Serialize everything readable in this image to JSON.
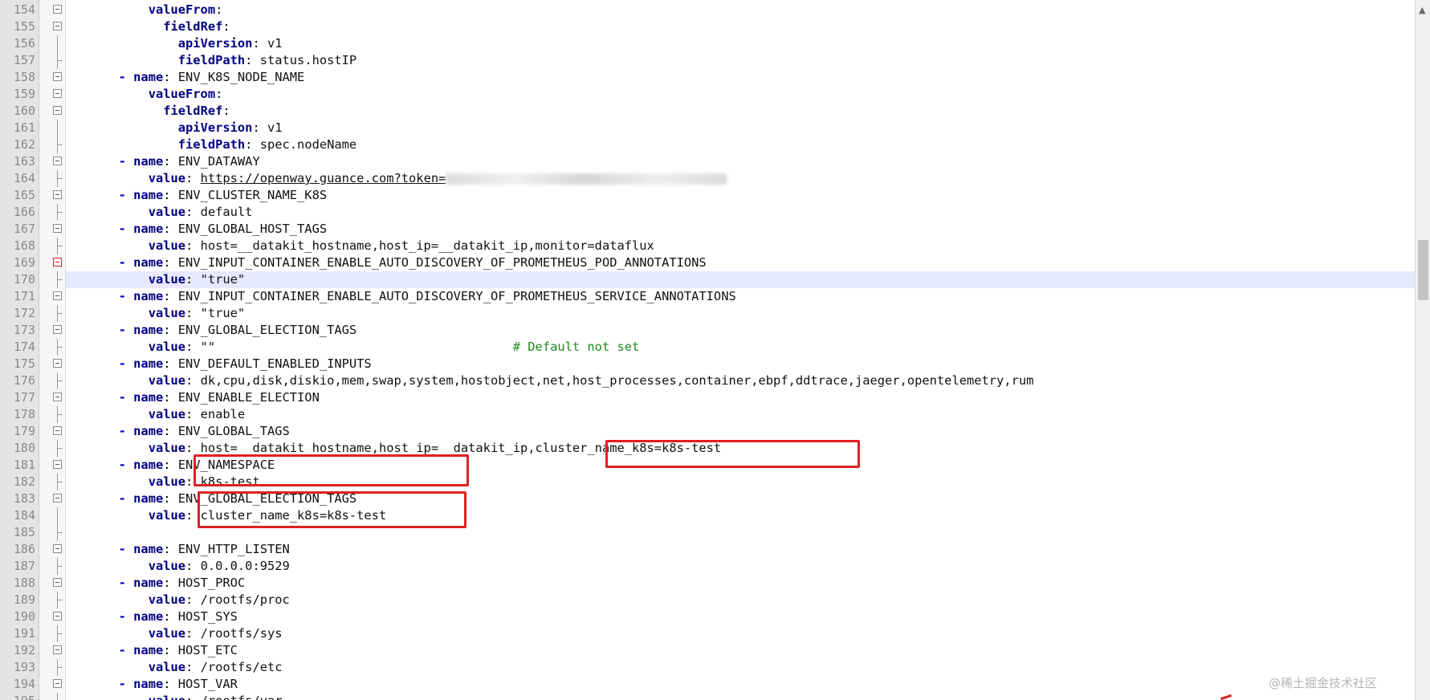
{
  "editor": {
    "current_line": 170,
    "lines": [
      {
        "n": "154",
        "fold": "box",
        "indent": 5,
        "dash": false,
        "key": "valueFrom",
        "colon": ":",
        "val": ""
      },
      {
        "n": "155",
        "fold": "box",
        "indent": 6,
        "dash": false,
        "key": "fieldRef",
        "colon": ":",
        "val": ""
      },
      {
        "n": "156",
        "fold": "line",
        "indent": 7,
        "dash": false,
        "key": "apiVersion",
        "colon": ":",
        "val": " v1"
      },
      {
        "n": "157",
        "fold": "end",
        "indent": 7,
        "dash": false,
        "key": "fieldPath",
        "colon": ":",
        "val": " status.hostIP"
      },
      {
        "n": "158",
        "fold": "box",
        "indent": 4,
        "dash": true,
        "key": "name",
        "colon": ":",
        "val": " ENV_K8S_NODE_NAME"
      },
      {
        "n": "159",
        "fold": "box",
        "indent": 5,
        "dash": false,
        "key": "valueFrom",
        "colon": ":",
        "val": ""
      },
      {
        "n": "160",
        "fold": "box",
        "indent": 6,
        "dash": false,
        "key": "fieldRef",
        "colon": ":",
        "val": ""
      },
      {
        "n": "161",
        "fold": "line",
        "indent": 7,
        "dash": false,
        "key": "apiVersion",
        "colon": ":",
        "val": " v1"
      },
      {
        "n": "162",
        "fold": "end",
        "indent": 7,
        "dash": false,
        "key": "fieldPath",
        "colon": ":",
        "val": " spec.nodeName"
      },
      {
        "n": "163",
        "fold": "box",
        "indent": 4,
        "dash": true,
        "key": "name",
        "colon": ":",
        "val": " ENV_DATAWAY"
      },
      {
        "n": "164",
        "fold": "end",
        "indent": 5,
        "dash": false,
        "key": "value",
        "colon": ":",
        "val": " ",
        "url": "https://openway.guance.com?token=",
        "blur": true
      },
      {
        "n": "165",
        "fold": "box",
        "indent": 4,
        "dash": true,
        "key": "name",
        "colon": ":",
        "val": " ENV_CLUSTER_NAME_K8S"
      },
      {
        "n": "166",
        "fold": "end",
        "indent": 5,
        "dash": false,
        "key": "value",
        "colon": ":",
        "val": " default"
      },
      {
        "n": "167",
        "fold": "box",
        "indent": 4,
        "dash": true,
        "key": "name",
        "colon": ":",
        "val": " ENV_GLOBAL_HOST_TAGS"
      },
      {
        "n": "168",
        "fold": "end",
        "indent": 5,
        "dash": false,
        "key": "value",
        "colon": ":",
        "val": " host=__datakit_hostname,host_ip=__datakit_ip,monitor=dataflux"
      },
      {
        "n": "169",
        "fold": "redbox",
        "indent": 4,
        "dash": true,
        "key": "name",
        "colon": ":",
        "val": " ENV_INPUT_CONTAINER_ENABLE_AUTO_DISCOVERY_OF_PROMETHEUS_POD_ANNOTATIONS"
      },
      {
        "n": "170",
        "fold": "end",
        "indent": 5,
        "dash": false,
        "key": "value",
        "colon": ":",
        "val": " \"true\""
      },
      {
        "n": "171",
        "fold": "box",
        "indent": 4,
        "dash": true,
        "key": "name",
        "colon": ":",
        "val": " ENV_INPUT_CONTAINER_ENABLE_AUTO_DISCOVERY_OF_PROMETHEUS_SERVICE_ANNOTATIONS"
      },
      {
        "n": "172",
        "fold": "end",
        "indent": 5,
        "dash": false,
        "key": "value",
        "colon": ":",
        "val": " \"true\""
      },
      {
        "n": "173",
        "fold": "box",
        "indent": 4,
        "dash": true,
        "key": "name",
        "colon": ":",
        "val": " ENV_GLOBAL_ELECTION_TAGS"
      },
      {
        "n": "174",
        "fold": "end",
        "indent": 5,
        "dash": false,
        "key": "value",
        "colon": ":",
        "val": " \"\"                                        ",
        "comment": "# Default not set"
      },
      {
        "n": "175",
        "fold": "box",
        "indent": 4,
        "dash": true,
        "key": "name",
        "colon": ":",
        "val": " ENV_DEFAULT_ENABLED_INPUTS"
      },
      {
        "n": "176",
        "fold": "end",
        "indent": 5,
        "dash": false,
        "key": "value",
        "colon": ":",
        "val": " dk,cpu,disk,diskio,mem,swap,system,hostobject,net,host_processes,container,ebpf,ddtrace,jaeger,opentelemetry,rum"
      },
      {
        "n": "177",
        "fold": "box",
        "indent": 4,
        "dash": true,
        "key": "name",
        "colon": ":",
        "val": " ENV_ENABLE_ELECTION"
      },
      {
        "n": "178",
        "fold": "end",
        "indent": 5,
        "dash": false,
        "key": "value",
        "colon": ":",
        "val": " enable"
      },
      {
        "n": "179",
        "fold": "box",
        "indent": 4,
        "dash": true,
        "key": "name",
        "colon": ":",
        "val": " ENV_GLOBAL_TAGS"
      },
      {
        "n": "180",
        "fold": "end",
        "indent": 5,
        "dash": false,
        "key": "value",
        "colon": ":",
        "val": " host=__datakit_hostname,host_ip=__datakit_ip,cluster_name_k8s=k8s-test"
      },
      {
        "n": "181",
        "fold": "box",
        "indent": 4,
        "dash": true,
        "key": "name",
        "colon": ":",
        "val": " ENV_NAMESPACE"
      },
      {
        "n": "182",
        "fold": "end",
        "indent": 5,
        "dash": false,
        "key": "value",
        "colon": ":",
        "val": " k8s-test"
      },
      {
        "n": "183",
        "fold": "box",
        "indent": 4,
        "dash": true,
        "key": "name",
        "colon": ":",
        "val": " ENV_GLOBAL_ELECTION_TAGS"
      },
      {
        "n": "184",
        "fold": "line",
        "indent": 5,
        "dash": false,
        "key": "value",
        "colon": ":",
        "val": " cluster_name_k8s=k8s-test"
      },
      {
        "n": "185",
        "fold": "end",
        "indent": 0,
        "dash": false,
        "key": "",
        "colon": "",
        "val": ""
      },
      {
        "n": "186",
        "fold": "box",
        "indent": 4,
        "dash": true,
        "key": "name",
        "colon": ":",
        "val": " ENV_HTTP_LISTEN"
      },
      {
        "n": "187",
        "fold": "end",
        "indent": 5,
        "dash": false,
        "key": "value",
        "colon": ":",
        "val": " 0.0.0.0:9529"
      },
      {
        "n": "188",
        "fold": "box",
        "indent": 4,
        "dash": true,
        "key": "name",
        "colon": ":",
        "val": " HOST_PROC"
      },
      {
        "n": "189",
        "fold": "end",
        "indent": 5,
        "dash": false,
        "key": "value",
        "colon": ":",
        "val": " /rootfs/proc"
      },
      {
        "n": "190",
        "fold": "box",
        "indent": 4,
        "dash": true,
        "key": "name",
        "colon": ":",
        "val": " HOST_SYS"
      },
      {
        "n": "191",
        "fold": "end",
        "indent": 5,
        "dash": false,
        "key": "value",
        "colon": ":",
        "val": " /rootfs/sys"
      },
      {
        "n": "192",
        "fold": "box",
        "indent": 4,
        "dash": true,
        "key": "name",
        "colon": ":",
        "val": " HOST_ETC"
      },
      {
        "n": "193",
        "fold": "end",
        "indent": 5,
        "dash": false,
        "key": "value",
        "colon": ":",
        "val": " /rootfs/etc"
      },
      {
        "n": "194",
        "fold": "box",
        "indent": 4,
        "dash": true,
        "key": "name",
        "colon": ":",
        "val": " HOST_VAR"
      },
      {
        "n": "195",
        "fold": "end",
        "indent": 5,
        "dash": false,
        "key": "value",
        "colon": ":",
        "val": " /rootfs/var"
      }
    ]
  },
  "scrollbar": {
    "up_arrow_icon": "chevron-up-icon",
    "up_arrow_glyph": "▲"
  },
  "watermark": {
    "text": "@稀土掘金技术社区"
  },
  "colors": {
    "key": "#000080",
    "dash": "#0000c0",
    "comment": "#1e8a1e",
    "highlight": "#e8e8ff",
    "annotation": "#e02020"
  }
}
